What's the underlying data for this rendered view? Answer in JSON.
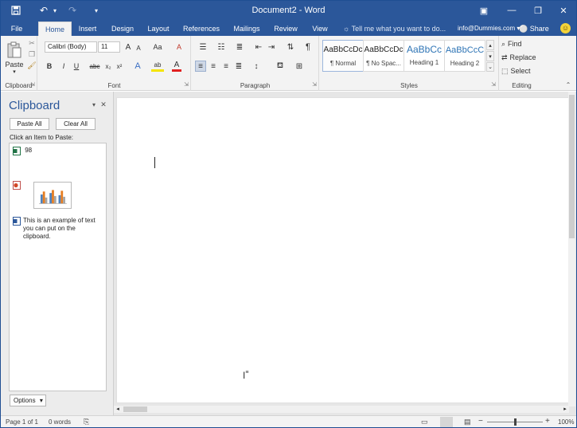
{
  "window": {
    "title": "Document2 - Word"
  },
  "quick_access": {
    "save_glyph": "💾",
    "undo_glyph": "↶",
    "redo_glyph": "↷",
    "customize_glyph": "▾"
  },
  "window_controls": {
    "options": "▣",
    "minimize": "—",
    "maximize": "❐",
    "close": "✕"
  },
  "tabs": [
    {
      "label": "File"
    },
    {
      "label": "Home"
    },
    {
      "label": "Insert"
    },
    {
      "label": "Design"
    },
    {
      "label": "Layout"
    },
    {
      "label": "References"
    },
    {
      "label": "Mailings"
    },
    {
      "label": "Review"
    },
    {
      "label": "View"
    }
  ],
  "tellme": {
    "text": "Tell me what you want to do..."
  },
  "account": {
    "email": "info@Dummies.com",
    "dropdown": "▾"
  },
  "share": {
    "label": "Share"
  },
  "ribbon": {
    "clipboard": {
      "label": "Clipboard",
      "paste": "Paste"
    },
    "font": {
      "label": "Font",
      "family": "Calibri (Body)",
      "size": "11",
      "buttons": {
        "grow": "A",
        "shrink": "A",
        "case": "Aa",
        "clear": "A",
        "bold": "B",
        "italic": "I",
        "underline": "U",
        "strike": "abc",
        "sub": "x₂",
        "sup": "x²",
        "effects": "A",
        "highlight": "ab",
        "color": "A"
      }
    },
    "paragraph": {
      "label": "Paragraph"
    },
    "styles": {
      "label": "Styles",
      "items": [
        {
          "preview": "AaBbCcDc",
          "name": "¶ Normal"
        },
        {
          "preview": "AaBbCcDc",
          "name": "¶ No Spac..."
        },
        {
          "preview": "AaBbCc",
          "name": "Heading 1"
        },
        {
          "preview": "AaBbCcC",
          "name": "Heading 2"
        }
      ]
    },
    "editing": {
      "label": "Editing",
      "find": "Find",
      "replace": "Replace",
      "select": "Select"
    }
  },
  "clipboard_pane": {
    "title": "Clipboard",
    "paste_all": "Paste All",
    "clear_all": "Clear All",
    "hint": "Click an Item to Paste:",
    "items": [
      {
        "text": "98"
      },
      {
        "text": ""
      },
      {
        "text": "This is an example of text you can put on the clipboard."
      }
    ],
    "options": "Options",
    "options_arrow": "▾",
    "pane_menu": "▾",
    "close": "✕"
  },
  "status": {
    "page": "Page 1 of 1",
    "words": "0 words",
    "zoom": "100%"
  },
  "colors": {
    "brand": "#2b579a",
    "accent_orange": "#e67e22"
  }
}
